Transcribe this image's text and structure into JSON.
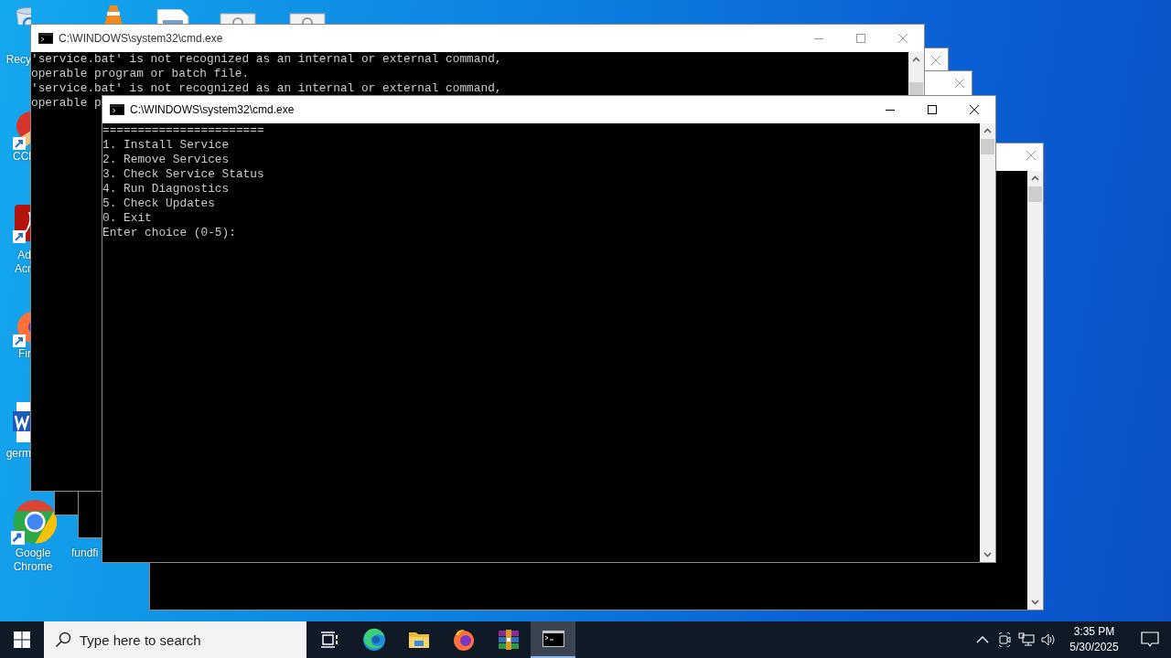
{
  "desktop_icons": [
    {
      "kind": "recycle-bin",
      "label": "Recy"
    },
    {
      "kind": "cone"
    },
    {
      "kind": "document"
    },
    {
      "kind": "gear-file"
    },
    {
      "kind": "gear-file"
    },
    {
      "kind": "cleaner",
      "label": "CCl"
    },
    {
      "kind": "acrobat",
      "label": "Ad Acr"
    },
    {
      "kind": "firefox",
      "label": "Fir"
    },
    {
      "kind": "word",
      "label": "germ"
    },
    {
      "kind": "chrome",
      "label": "Google Chrome"
    },
    {
      "kind": "blank",
      "label": "fundfi"
    }
  ],
  "windows": [
    {
      "kind": "edge",
      "active": false
    },
    {
      "kind": "edge",
      "active": false
    },
    {
      "kind": "edge",
      "active": false
    },
    {
      "kind": "console",
      "active": false,
      "title": "C:\\WINDOWS\\system32\\cmd.exe",
      "lines": [
        "'service.bat' is not recognized as an internal or external command,",
        "operable program or batch file.",
        "'service.bat' is not recognized as an internal or external command,",
        "operable p"
      ]
    },
    {
      "kind": "console",
      "active": true,
      "title": "C:\\WINDOWS\\system32\\cmd.exe",
      "lines": [
        "=======================",
        "1. Install Service",
        "2. Remove Services",
        "3. Check Service Status",
        "4. Run Diagnostics",
        "5. Check Updates",
        "0. Exit",
        "Enter choice (0-5):"
      ]
    }
  ],
  "taskbar": {
    "search": {
      "placeholder": "Type here to search"
    },
    "apps": [
      {
        "kind": "task-view",
        "selected": false
      },
      {
        "kind": "edge",
        "selected": false
      },
      {
        "kind": "explorer",
        "selected": false
      },
      {
        "kind": "firefox",
        "selected": false
      },
      {
        "kind": "winrar",
        "selected": false
      },
      {
        "kind": "cmd",
        "selected": true
      }
    ],
    "tray": [
      {
        "kind": "caret"
      },
      {
        "kind": "meet"
      },
      {
        "kind": "network"
      },
      {
        "kind": "volume"
      }
    ],
    "time": "3:35 PM",
    "date": "5/30/2025"
  }
}
